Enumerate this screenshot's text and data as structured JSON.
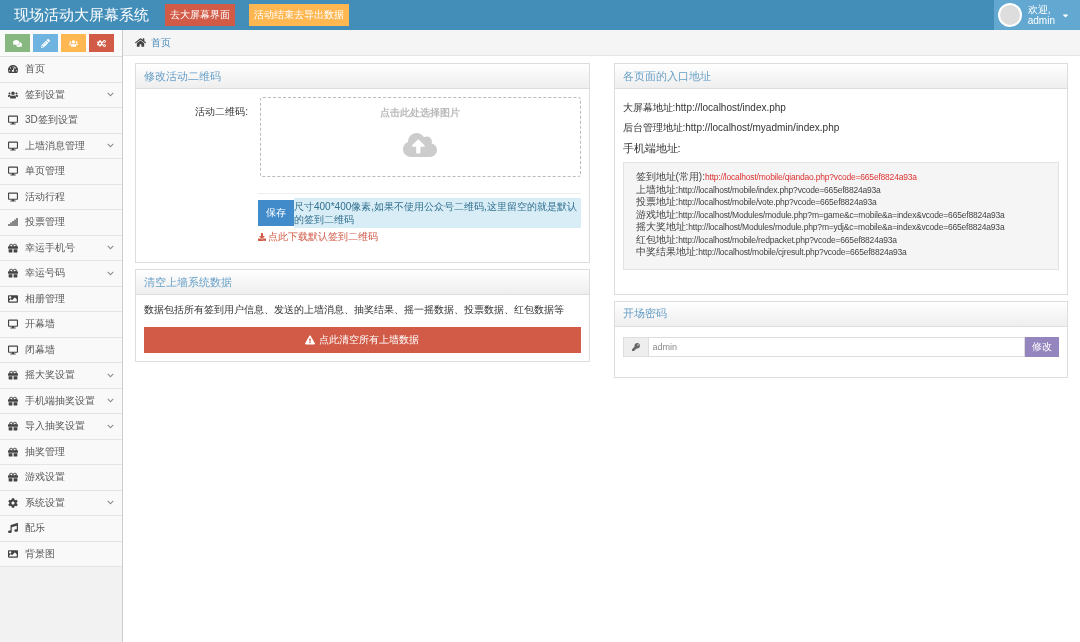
{
  "header": {
    "title": "现场活动大屏幕系统",
    "buttons": [
      {
        "label": "去大屏幕界面",
        "color": "#d15b47"
      },
      {
        "label": "活动结束去导出数据",
        "color": "#ffb752"
      }
    ],
    "user": {
      "greeting": "欢迎,",
      "name": "admin"
    }
  },
  "shortcuts": [
    {
      "kind": "comments",
      "color": "#87b87f"
    },
    {
      "kind": "pencil",
      "color": "#6fb3e0"
    },
    {
      "kind": "users",
      "color": "#ffb752"
    },
    {
      "kind": "cogs",
      "color": "#d15b47"
    }
  ],
  "breadcrumb": {
    "label": "首页"
  },
  "sidebar": {
    "items": [
      {
        "label": "首页",
        "kind": "dashboard",
        "submenu": false
      },
      {
        "label": "签到设置",
        "kind": "users",
        "submenu": true
      },
      {
        "label": "3D签到设置",
        "kind": "desktop",
        "submenu": false
      },
      {
        "label": "上墙消息管理",
        "kind": "desktop",
        "submenu": true
      },
      {
        "label": "单页管理",
        "kind": "desktop",
        "submenu": false
      },
      {
        "label": "活动行程",
        "kind": "desktop",
        "submenu": false
      },
      {
        "label": "投票管理",
        "kind": "signal",
        "submenu": false
      },
      {
        "label": "幸运手机号",
        "kind": "gift",
        "submenu": true
      },
      {
        "label": "幸运号码",
        "kind": "gift",
        "submenu": true
      },
      {
        "label": "相册管理",
        "kind": "picture",
        "submenu": false
      },
      {
        "label": "开幕墙",
        "kind": "desktop",
        "submenu": false
      },
      {
        "label": "闭幕墙",
        "kind": "desktop",
        "submenu": false
      },
      {
        "label": "摇大奖设置",
        "kind": "gift",
        "submenu": true
      },
      {
        "label": "手机端抽奖设置",
        "kind": "gift",
        "submenu": true
      },
      {
        "label": "导入抽奖设置",
        "kind": "gift",
        "submenu": true
      },
      {
        "label": "抽奖管理",
        "kind": "gift",
        "submenu": false
      },
      {
        "label": "游戏设置",
        "kind": "gift",
        "submenu": false
      },
      {
        "label": "系统设置",
        "kind": "cog",
        "submenu": true
      },
      {
        "label": "配乐",
        "kind": "music",
        "submenu": false
      },
      {
        "label": "背景图",
        "kind": "picture",
        "submenu": false
      }
    ]
  },
  "qrcode_panel": {
    "title": "修改活动二维码",
    "field_label": "活动二维码:",
    "upload_hint": "点击此处选择图片",
    "save_button": "保存",
    "note": "尺寸400*400像素,如果不使用公众号二维码,这里留空的就是默认的签到二维码",
    "download_link": "点此下载默认签到二维码"
  },
  "clear_panel": {
    "title": "清空上墙系统数据",
    "description": "数据包括所有签到用户信息、发送的上墙消息、抽奖结果、摇一摇数据、投票数据、红包数据等",
    "button": "点此清空所有上墙数据"
  },
  "address_panel": {
    "title": "各页面的入口地址",
    "lines": [
      {
        "label": "大屏幕地址:",
        "url": "http://localhost/index.php"
      },
      {
        "label": "后台管理地址:",
        "url": "http://localhost/myadmin/index.php"
      }
    ],
    "mobile_heading": "手机端地址:",
    "mobile_lines": [
      {
        "label": "签到地址(常用):",
        "url": "http://localhost/mobile/qiandao.php?vcode=665ef8824a93a",
        "highlight": true
      },
      {
        "label": "上墙地址:",
        "url": "http://localhost/mobile/index.php?vcode=665ef8824a93a",
        "highlight": false
      },
      {
        "label": "投票地址:",
        "url": "http://localhost/mobile/vote.php?vcode=665ef8824a93a",
        "highlight": false
      },
      {
        "label": "游戏地址:",
        "url": "http://localhost/Modules/module.php?m=game&c=mobile&a=index&vcode=665ef8824a93a",
        "highlight": false
      },
      {
        "label": "摇大奖地址:",
        "url": "http://localhost/Modules/module.php?m=ydj&c=mobile&a=index&vcode=665ef8824a93a",
        "highlight": false
      },
      {
        "label": "红包地址:",
        "url": "http://localhost/mobile/redpacket.php?vcode=665ef8824a93a",
        "highlight": false
      },
      {
        "label": "中奖结果地址:",
        "url": "http://localhost/mobile/cjresult.php?vcode=665ef8824a93a",
        "highlight": false
      }
    ]
  },
  "password_panel": {
    "title": "开场密码",
    "value": "admin",
    "button": "修改"
  }
}
